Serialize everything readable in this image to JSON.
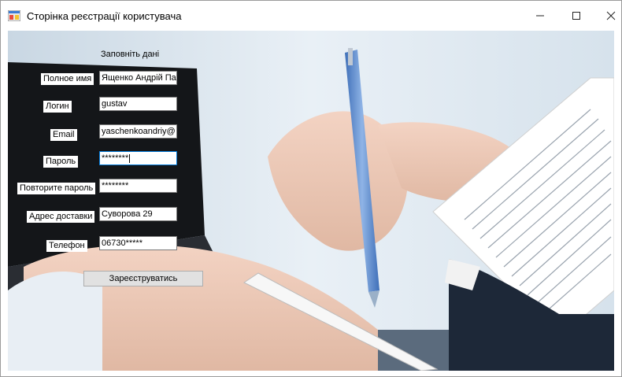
{
  "window": {
    "title": "Сторінка реєстрації користувача",
    "controls": {
      "minimize": "—",
      "maximize": "☐",
      "close": "✕"
    }
  },
  "form": {
    "heading": "Заповніть дані",
    "fields": [
      {
        "label": "Полное имя",
        "value": "Ященко Андрій Па"
      },
      {
        "label": "Логин",
        "value": "gustav"
      },
      {
        "label": "Email",
        "value": "yaschenkoandriy@"
      },
      {
        "label": "Пароль",
        "value": "********"
      },
      {
        "label": "Повторите пароль",
        "value": "********"
      },
      {
        "label": "Адрес доставки",
        "value": "Суворова 29"
      },
      {
        "label": "Телефон",
        "value": "06730*****"
      }
    ],
    "submit_label": "Зареєструватись"
  },
  "colors": {
    "focus_border": "#0078d7",
    "button_bg": "#e1e1e1",
    "pen_blue": "#5a88c8"
  }
}
